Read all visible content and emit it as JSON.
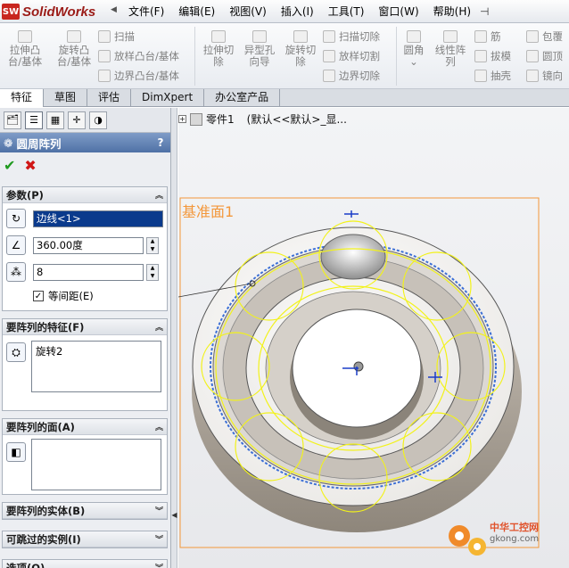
{
  "app": {
    "logo_text": "SolidWorks",
    "logo_badge": "SW"
  },
  "menu": [
    "文件(F)",
    "编辑(E)",
    "视图(V)",
    "插入(I)",
    "工具(T)",
    "窗口(W)",
    "帮助(H)"
  ],
  "ribbon": {
    "extrude_boss": [
      "拉伸凸",
      "台/基体"
    ],
    "revolve_boss": [
      "旋转凸",
      "台/基体"
    ],
    "sweep": "扫描",
    "loft_boss": "放样凸台/基体",
    "boundary_boss": "边界凸台/基体",
    "extrude_cut": [
      "拉伸切",
      "除"
    ],
    "hole_wizard": [
      "异型孔",
      "向导"
    ],
    "revolve_cut": [
      "旋转切",
      "除"
    ],
    "sweep_cut": "扫描切除",
    "loft_cut": "放样切割",
    "boundary_cut": "边界切除",
    "fillet": "圆角",
    "linear_pattern": [
      "线性阵",
      "列"
    ],
    "rib": "筋",
    "draft": "拔模",
    "shell": "抽壳",
    "wrap": "包覆",
    "dome": "圆顶",
    "mirror": "镜向"
  },
  "tabs": [
    "特征",
    "草图",
    "评估",
    "DimXpert",
    "办公室产品"
  ],
  "panel": {
    "title": "圆周阵列",
    "help": "?",
    "params": {
      "heading": "参数(P)",
      "direction_value": "边线<1>",
      "angle_value": "360.00度",
      "count_value": "8",
      "equal_spacing_label": "等间距(E)",
      "equal_spacing_checked": true
    },
    "features": {
      "heading": "要阵列的特征(F)",
      "items": [
        "旋转2"
      ]
    },
    "faces": {
      "heading": "要阵列的面(A)"
    },
    "bodies": {
      "heading": "要阵列的实体(B)"
    },
    "skip": {
      "heading": "可跳过的实例(I)"
    },
    "options": {
      "heading": "选项(O)"
    }
  },
  "graphics": {
    "tree_label": "零件1",
    "tree_config": "(默认<<默认>_显...",
    "plane_label": "基准面1",
    "watermark_cn": "中华工控网",
    "watermark_url": "gkong.com",
    "plane_color": "#f3973a",
    "sketch_color": "#f2f21a",
    "axis_color": "#1a3dc8"
  },
  "colors": {
    "accent": "#4f71a6",
    "ok": "#1f9a1f",
    "cancel": "#d01616"
  }
}
